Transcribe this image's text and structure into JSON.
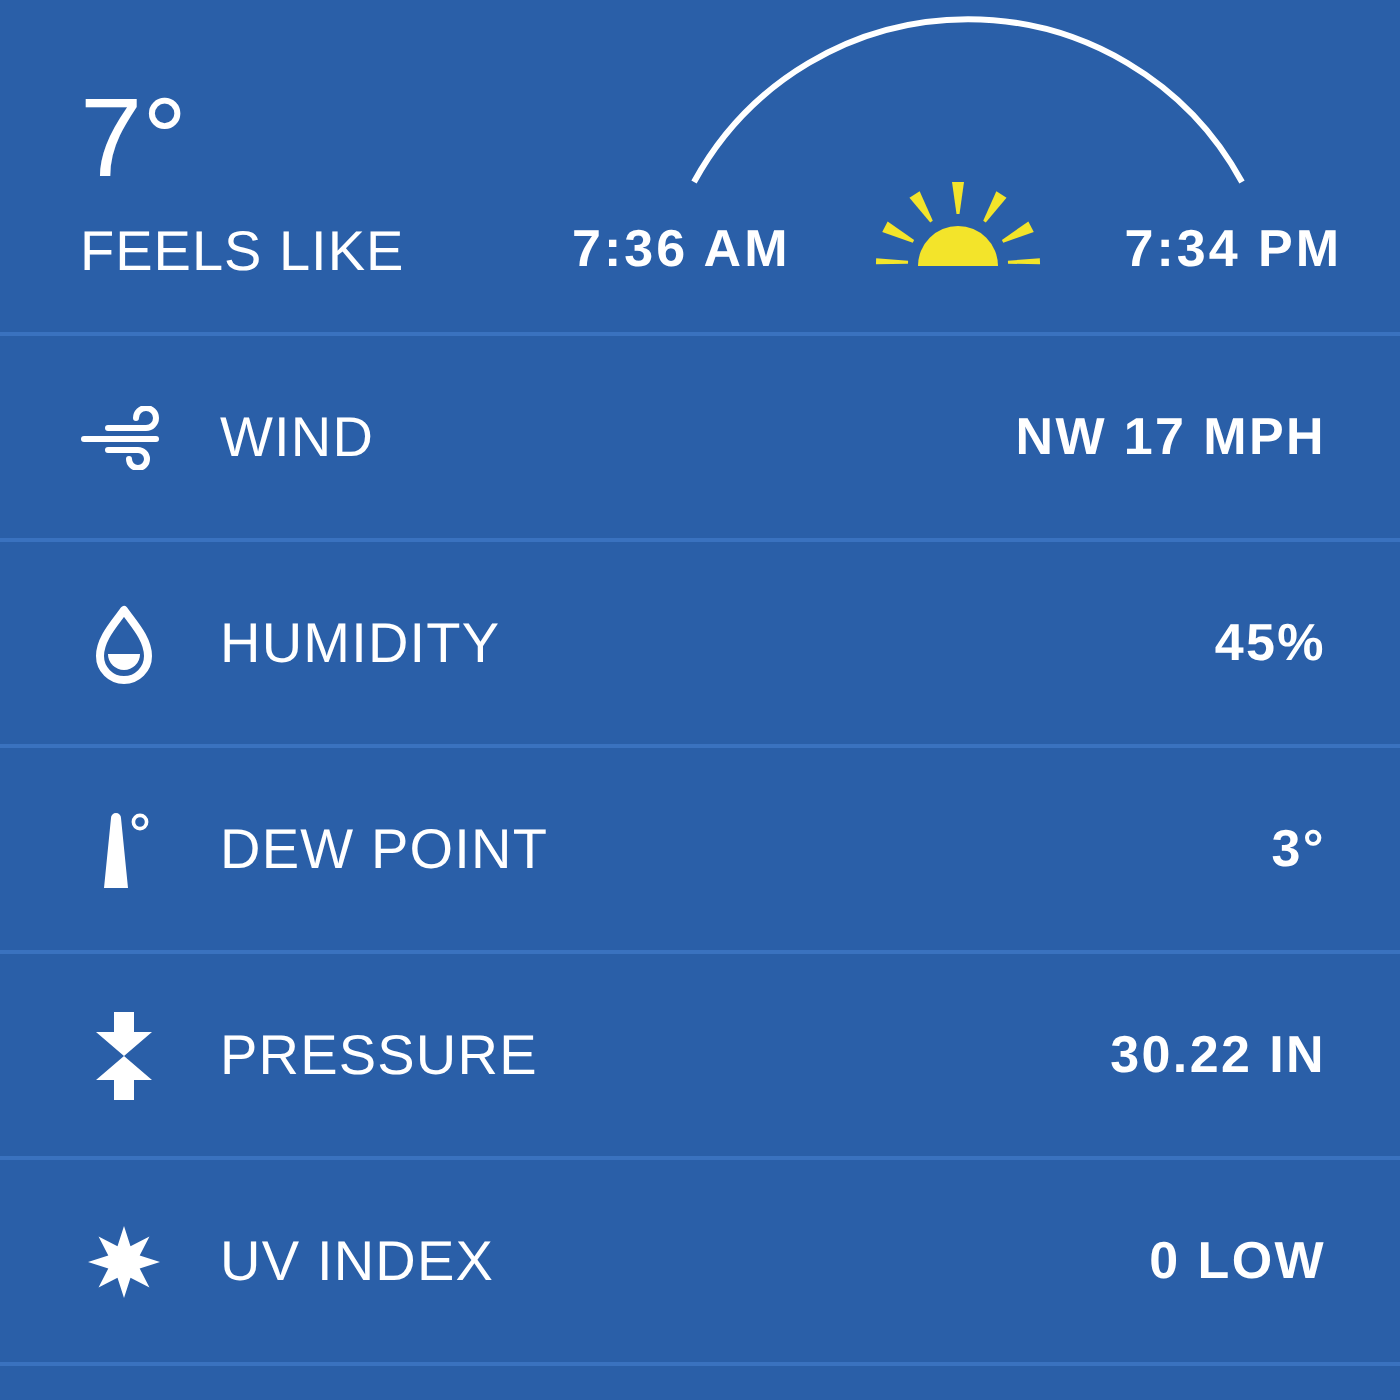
{
  "current": {
    "temperature": "7°",
    "feels_like_label": "FEELS LIKE"
  },
  "sun": {
    "sunrise": "7:36 AM",
    "sunset": "7:34 PM"
  },
  "details": [
    {
      "kind": "wind",
      "label": "WIND",
      "value": "NW 17 MPH"
    },
    {
      "kind": "humidity",
      "label": "HUMIDITY",
      "value": "45%"
    },
    {
      "kind": "dew_point",
      "label": "DEW POINT",
      "value": "3°"
    },
    {
      "kind": "pressure",
      "label": "PRESSURE",
      "value": "30.22 IN"
    },
    {
      "kind": "uv_index",
      "label": "UV INDEX",
      "value": "0 LOW"
    }
  ]
}
